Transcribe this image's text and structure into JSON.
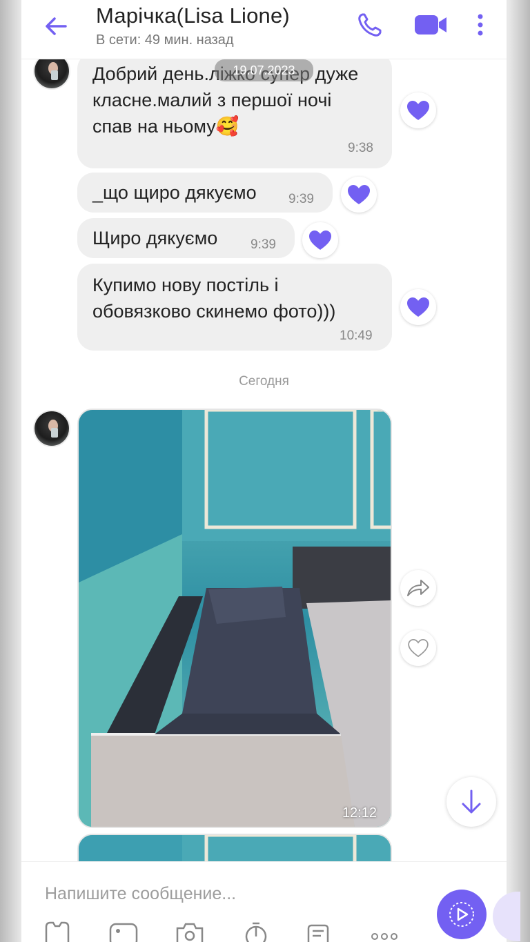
{
  "header": {
    "title": "Марічка(Lisa Lione)",
    "status": "В сети: 49 мин. назад"
  },
  "chat": {
    "date_pill": "19.07.2023",
    "messages": [
      {
        "text": "Добрий день.ліжко супер дуже класне.малий з першої ночі спав на ньому🥰",
        "time": "9:38",
        "liked": true
      },
      {
        "text": "_що щиро дякуємо",
        "time": "9:39",
        "liked": true
      },
      {
        "text": "Щиро дякуємо",
        "time": "9:39",
        "liked": true
      },
      {
        "text": "Купимо нову постіль і обовязково скинемо фото)))",
        "time": "10:49",
        "liked": true
      }
    ],
    "day_separator": "Сегодня",
    "photo_message": {
      "time": "12:12"
    }
  },
  "composer": {
    "placeholder": "Напишите сообщение..."
  },
  "colors": {
    "accent": "#7360f2",
    "bubble": "#efefef"
  },
  "icons": [
    "back-arrow-icon",
    "phone-icon",
    "video-camera-icon",
    "more-vertical-icon",
    "heart-icon",
    "share-icon",
    "arrow-down-icon",
    "sticker-icon",
    "gallery-icon",
    "camera-icon",
    "timer-icon",
    "poll-icon",
    "more-horizontal-icon",
    "send-icon"
  ]
}
